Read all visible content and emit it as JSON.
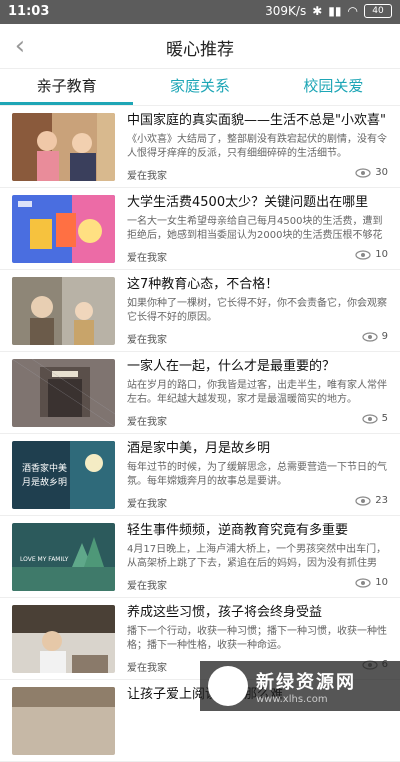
{
  "status": {
    "time": "11:03",
    "speed": "309K/s",
    "battery": "40"
  },
  "header": {
    "title": "暖心推荐"
  },
  "tabs": [
    {
      "label": "亲子教育"
    },
    {
      "label": "家庭关系"
    },
    {
      "label": "校园关爱"
    }
  ],
  "articles": [
    {
      "title": "中国家庭的真实面貌——生活不总是\"小欢喜\"",
      "desc": "《小欢喜》大结局了，整部剧没有跌宕起伏的剧情，没有令人恨得牙痒痒的反派，只有细细碎碎的生活细节。",
      "source": "爱在我家",
      "views": "30"
    },
    {
      "title": "大学生活费4500太少？关键问题出在哪里",
      "desc": "一名大一女生希望母亲给自己每月4500块的生活费，遭到拒绝后，她感到相当委屈认为2000块的生活费压根不够花",
      "source": "爱在我家",
      "views": "10"
    },
    {
      "title": "这7种教育心态，不合格！",
      "desc": "如果你种了一棵树，它长得不好，你不会责备它，你会观察它长得不好的原因。",
      "source": "爱在我家",
      "views": "9"
    },
    {
      "title": "一家人在一起，什么才是最重要的？",
      "desc": "站在岁月的路口，你我皆是过客，出走半生，唯有家人常伴左右。年纪越大越发现，家才是最温暖简实的地方。",
      "source": "爱在我家",
      "views": "5"
    },
    {
      "title": "酒是家中美，月是故乡明",
      "desc": "每年过节的时候，为了缓解思念，总需要营造一下节日的气氛。每年嫦娥奔月的故事总是要讲。",
      "source": "爱在我家",
      "views": "23"
    },
    {
      "title": "轻生事件频频，逆商教育究竟有多重要",
      "desc": "4月17日晚上，上海卢浦大桥上，一个男孩突然中出车门，从高架桥上跳了下去，紧追在后的妈妈，因为没有抓住男",
      "source": "爱在我家",
      "views": "10"
    },
    {
      "title": "养成这些习惯，孩子将会终身受益",
      "desc": "播下一个行动，收获一种习惯；播下一种习惯，收获一种性格；播下一种性格，收获一种命运。",
      "source": "爱在我家",
      "views": "6"
    },
    {
      "title": "让孩子爱上阅读，没那么难",
      "desc": "",
      "source": "",
      "views": ""
    }
  ],
  "thumb_captions": {
    "a2": "酒香家中美",
    "a2b": "月是故乡明",
    "a5": "LOVE MY FAMILY"
  },
  "watermark": {
    "title": "新绿资源网",
    "url": "www.xlhs.com"
  }
}
